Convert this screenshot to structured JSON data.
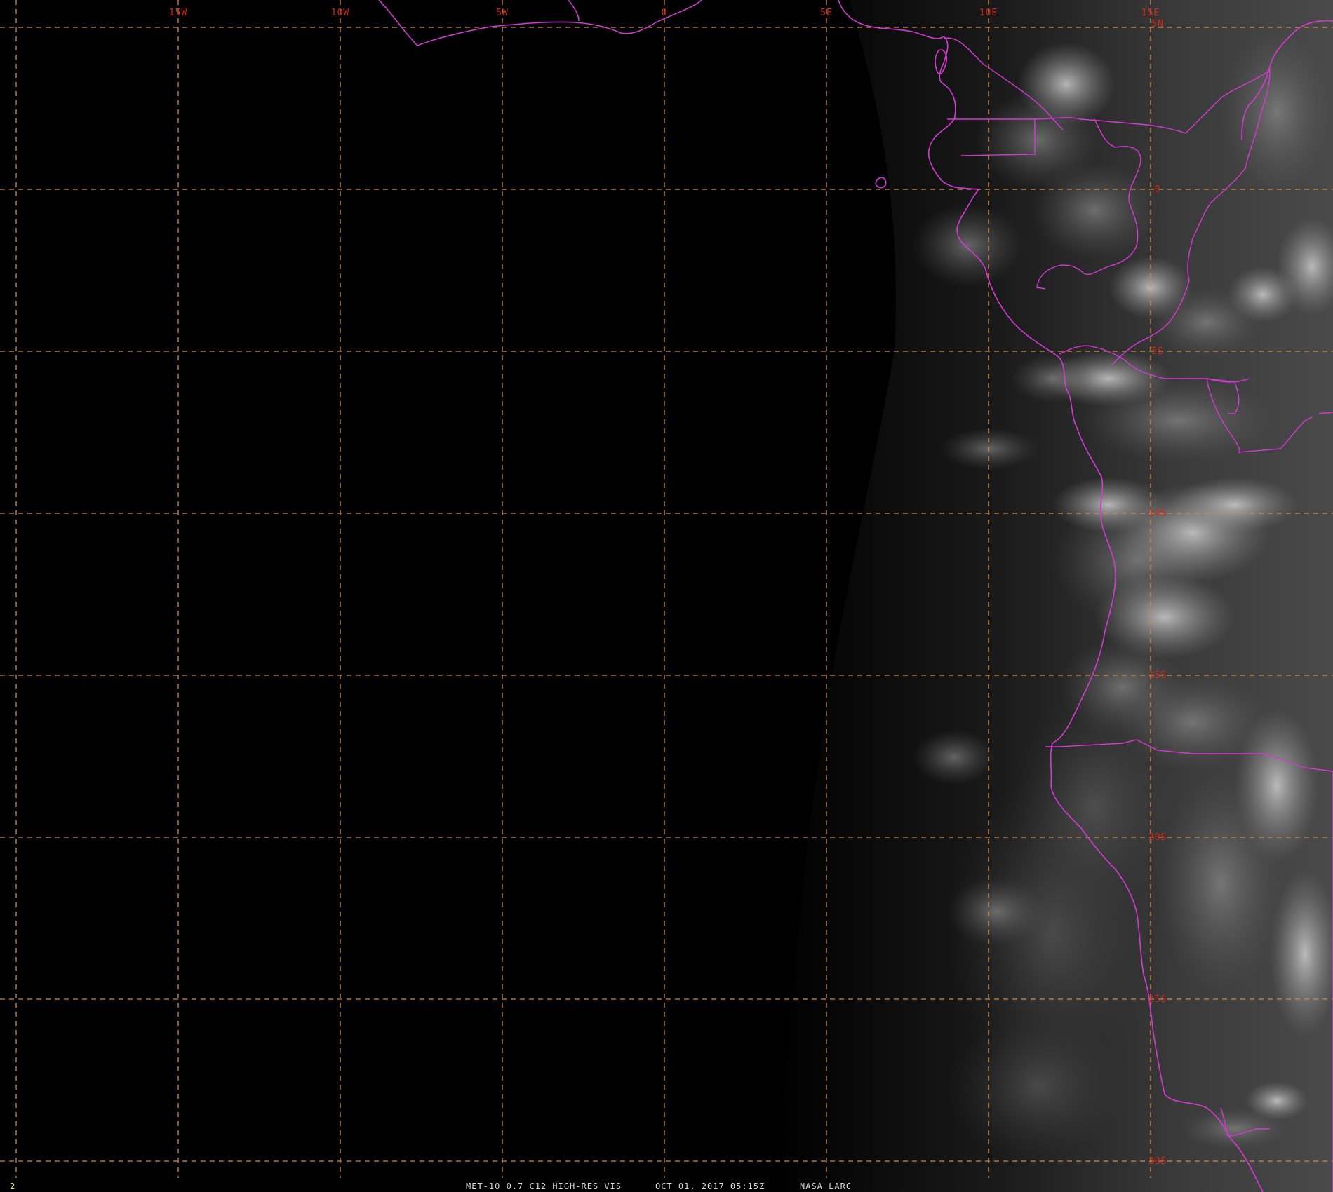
{
  "image": {
    "kind": "satellite-imagery",
    "description_colors": {
      "background": "#000000",
      "graticule": "#d08a4a",
      "graticule_label": "#d22a1e",
      "coastline": "#d43ad4",
      "footer_text": "#d8d8d8",
      "frame_number": "#e6e64a"
    }
  },
  "graticule": {
    "longitudes": [
      {
        "value": -20,
        "label": ""
      },
      {
        "value": -15,
        "label": "15W"
      },
      {
        "value": -10,
        "label": "10W"
      },
      {
        "value": -5,
        "label": "5W"
      },
      {
        "value": 0,
        "label": "0"
      },
      {
        "value": 5,
        "label": "5E"
      },
      {
        "value": 10,
        "label": "10E"
      },
      {
        "value": 15,
        "label": "15E"
      }
    ],
    "latitudes": [
      {
        "value": 5,
        "label": "5N"
      },
      {
        "value": 0,
        "label": "0"
      },
      {
        "value": -5,
        "label": "5S"
      },
      {
        "value": -10,
        "label": "10S"
      },
      {
        "value": -15,
        "label": "15S"
      },
      {
        "value": -20,
        "label": "20S"
      },
      {
        "value": -25,
        "label": "25S"
      },
      {
        "value": -30,
        "label": "30S"
      }
    ]
  },
  "footer": {
    "frame_number": "2",
    "product": "MET-10 0.7 C12 HIGH-RES VIS",
    "datetime": "OCT 01, 2017 05:15Z",
    "source": "NASA LARC"
  }
}
